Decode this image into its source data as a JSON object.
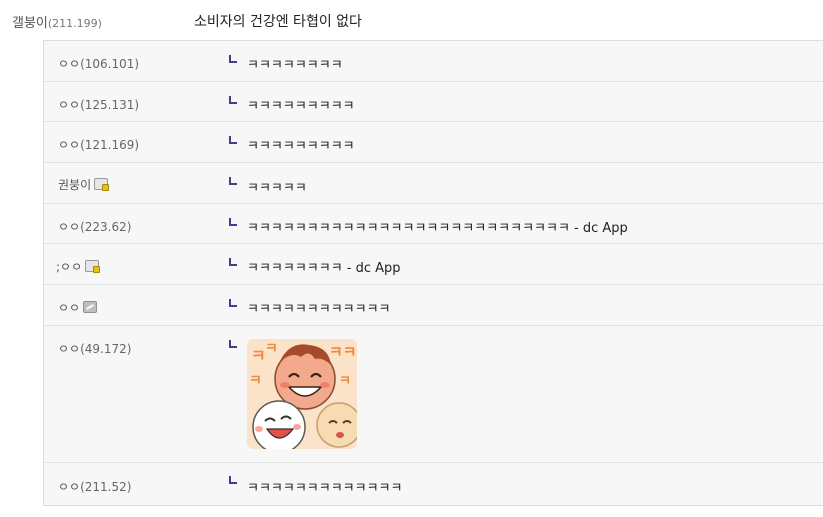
{
  "top_comment": {
    "author": "갤붕이",
    "ip": "(211.199)",
    "text": "소비자의 건강엔 타협이 없다"
  },
  "replies": [
    {
      "nick": "ㅇㅇ",
      "ip": "(106.101)",
      "text": "ㅋㅋㅋㅋㅋㅋㅋㅋ"
    },
    {
      "nick": "ㅇㅇ",
      "ip": "(125.131)",
      "text": "ㅋㅋㅋㅋㅋㅋㅋㅋㅋ"
    },
    {
      "nick": "ㅇㅇ",
      "ip": "(121.169)",
      "text": "ㅋㅋㅋㅋㅋㅋㅋㅋㅋ"
    },
    {
      "nick": "권붕이",
      "ip": "",
      "text": "ㅋㅋㅋㅋㅋ"
    },
    {
      "nick": "ㅇㅇ",
      "ip": "(223.62)",
      "text": "ㅋㅋㅋㅋㅋㅋㅋㅋㅋㅋㅋㅋㅋㅋㅋㅋㅋㅋㅋㅋㅋㅋㅋㅋㅋㅋㅋ - dc App"
    },
    {
      "nick": ";ㅇㅇ",
      "ip": "",
      "text": "ㅋㅋㅋㅋㅋㅋㅋㅋ - dc App"
    },
    {
      "nick": "ㅇㅇ",
      "ip": "",
      "text": "ㅋㅋㅋㅋㅋㅋㅋㅋㅋㅋㅋㅋ"
    },
    {
      "nick": "ㅇㅇ",
      "ip": "(49.172)",
      "text": ""
    },
    {
      "nick": "ㅇㅇ",
      "ip": "(211.52)",
      "text": "ㅋㅋㅋㅋㅋㅋㅋㅋㅋㅋㅋㅋㅋ"
    }
  ],
  "icons": {
    "reply_marker": "reply-arrow-icon",
    "member_icon": "member-lock-icon",
    "fixed_member_icon": "fixed-nick-icon",
    "dccon": "laughing-faces-dccon"
  },
  "colors": {
    "reply_background": "#f7f7f7",
    "reply_marker": "#3d3f8f",
    "lock": "#e3c21a"
  }
}
